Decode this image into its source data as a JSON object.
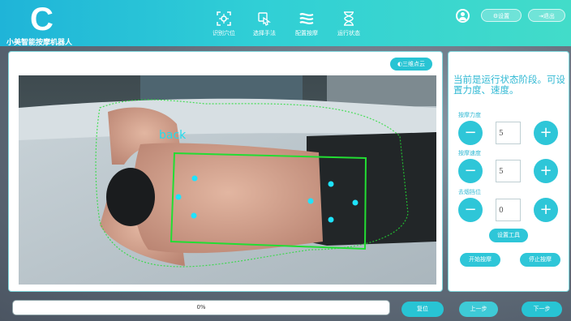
{
  "app": {
    "logo_letter": "C",
    "title": "小美智能按摩机器人"
  },
  "nav": {
    "items": [
      {
        "label": "识别穴位",
        "icon": "target-icon"
      },
      {
        "label": "选择手法",
        "icon": "hand-icon"
      },
      {
        "label": "配置按摩",
        "icon": "sliders-icon"
      },
      {
        "label": "运行状态",
        "icon": "hourglass-icon"
      }
    ],
    "active_index": 2
  },
  "header": {
    "settings_label": "⚙设置",
    "exit_label": "⇥退出"
  },
  "main": {
    "cloud_button_label": "◐三维点云",
    "camera_overlay_text": "back"
  },
  "side": {
    "hint": "当前是运行状态阶段。可设置力度、速度。",
    "params": [
      {
        "label": "按摩力度",
        "value": "5",
        "minus": "−",
        "plus": "+"
      },
      {
        "label": "按摩速度",
        "value": "5",
        "minus": "−",
        "plus": "+"
      },
      {
        "label": "去烟挡位",
        "value": "0",
        "minus": "−",
        "plus": "+"
      }
    ],
    "set_tool_label": "设置工具",
    "start_label": "开始按摩",
    "stop_label": "停止按摩"
  },
  "bottom": {
    "progress_text": "0%",
    "progress_value": 0,
    "reset_label": "复位",
    "prev_label": "上一步",
    "next_label": "下一步"
  },
  "colors": {
    "accent": "#2ec6d8",
    "header_start": "#1fb4d8",
    "header_end": "#42dcc9",
    "box_green": "#22dd33",
    "point_cyan": "#1ee3ff"
  }
}
